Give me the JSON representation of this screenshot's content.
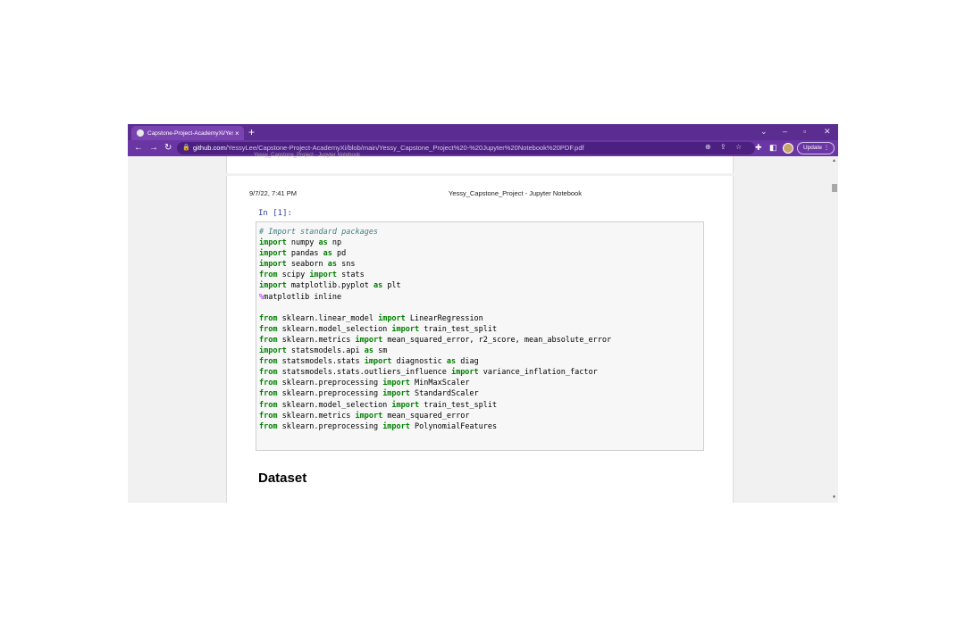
{
  "browser": {
    "tab_title": "Capstone-Project-AcademyXi/Yes",
    "tab_close": "×",
    "new_tab": "+",
    "url_host": "github.com",
    "url_path": "/YessyLee/Capstone-Project-AcademyXi/blob/main/Yessy_Capstone_Project%20-%20Jupyter%20Notebook%20PDF.pdf",
    "update_label": "Update",
    "accent_color": "#5c2d91"
  },
  "pdf": {
    "previous_page_header": "Yessy_Capstone_Project - Jupyter Notebook",
    "date": "9/7/22, 7:41 PM",
    "title": "Yessy_Capstone_Project - Jupyter Notebook",
    "prompt": "In [1]:",
    "code_lines": [
      [
        {
          "c": "cm",
          "t": "# Import standard packages"
        }
      ],
      [
        {
          "c": "kw",
          "t": "import"
        },
        {
          "t": " numpy "
        },
        {
          "c": "kw",
          "t": "as"
        },
        {
          "t": " np"
        }
      ],
      [
        {
          "c": "kw",
          "t": "import"
        },
        {
          "t": " pandas "
        },
        {
          "c": "kw",
          "t": "as"
        },
        {
          "t": " pd"
        }
      ],
      [
        {
          "c": "kw",
          "t": "import"
        },
        {
          "t": " seaborn "
        },
        {
          "c": "kw",
          "t": "as"
        },
        {
          "t": " sns"
        }
      ],
      [
        {
          "c": "kw",
          "t": "from"
        },
        {
          "t": " scipy "
        },
        {
          "c": "kw",
          "t": "import"
        },
        {
          "t": " stats"
        }
      ],
      [
        {
          "c": "kw",
          "t": "import"
        },
        {
          "t": " matplotlib.pyplot "
        },
        {
          "c": "kw",
          "t": "as"
        },
        {
          "t": " plt"
        }
      ],
      [
        {
          "c": "mg",
          "t": "%"
        },
        {
          "t": "matplotlib inline"
        }
      ],
      [],
      [
        {
          "c": "kw",
          "t": "from"
        },
        {
          "t": " sklearn.linear_model "
        },
        {
          "c": "kw",
          "t": "import"
        },
        {
          "t": " LinearRegression"
        }
      ],
      [
        {
          "c": "kw",
          "t": "from"
        },
        {
          "t": " sklearn.model_selection "
        },
        {
          "c": "kw",
          "t": "import"
        },
        {
          "t": " train_test_split"
        }
      ],
      [
        {
          "c": "kw",
          "t": "from"
        },
        {
          "t": " sklearn.metrics "
        },
        {
          "c": "kw",
          "t": "import"
        },
        {
          "t": " mean_squared_error, r2_score, mean_absolute_error"
        }
      ],
      [
        {
          "c": "kw",
          "t": "import"
        },
        {
          "t": " statsmodels.api "
        },
        {
          "c": "kw",
          "t": "as"
        },
        {
          "t": " sm"
        }
      ],
      [
        {
          "c": "kw",
          "t": "from"
        },
        {
          "t": " statsmodels.stats "
        },
        {
          "c": "kw",
          "t": "import"
        },
        {
          "t": " diagnostic "
        },
        {
          "c": "kw",
          "t": "as"
        },
        {
          "t": " diag"
        }
      ],
      [
        {
          "c": "kw",
          "t": "from"
        },
        {
          "t": " statsmodels.stats.outliers_influence "
        },
        {
          "c": "kw",
          "t": "import"
        },
        {
          "t": " variance_inflation_factor"
        }
      ],
      [
        {
          "c": "kw",
          "t": "from"
        },
        {
          "t": " sklearn.preprocessing "
        },
        {
          "c": "kw",
          "t": "import"
        },
        {
          "t": " MinMaxScaler"
        }
      ],
      [
        {
          "c": "kw",
          "t": "from"
        },
        {
          "t": " sklearn.preprocessing "
        },
        {
          "c": "kw",
          "t": "import"
        },
        {
          "t": " StandardScaler"
        }
      ],
      [
        {
          "c": "kw",
          "t": "from"
        },
        {
          "t": " sklearn.model_selection "
        },
        {
          "c": "kw",
          "t": "import"
        },
        {
          "t": " train_test_split"
        }
      ],
      [
        {
          "c": "kw",
          "t": "from"
        },
        {
          "t": " sklearn.metrics "
        },
        {
          "c": "kw",
          "t": "import"
        },
        {
          "t": " mean_squared_error"
        }
      ],
      [
        {
          "c": "kw",
          "t": "from"
        },
        {
          "t": " sklearn.preprocessing "
        },
        {
          "c": "kw",
          "t": "import"
        },
        {
          "t": " PolynomialFeatures"
        }
      ]
    ],
    "section_title": "Dataset"
  }
}
